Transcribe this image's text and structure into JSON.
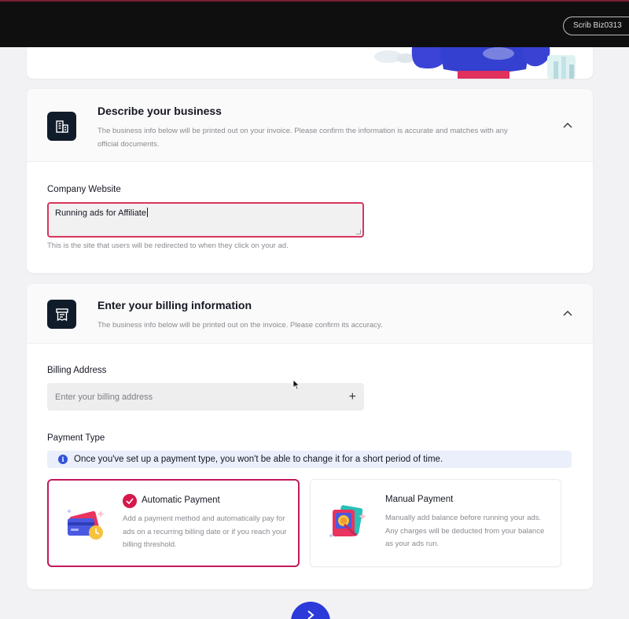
{
  "topbar": {
    "account_name": "Scrib Biz0313"
  },
  "business_section": {
    "title": "Describe your business",
    "description": "The business info below will be printed out on your invoice. Please confirm the information is accurate and matches with any official documents.",
    "icon": "building-icon",
    "website_label": "Company Website",
    "website_value": "Running ads for Affiliate",
    "website_helper": "This is the site that users will be redirected to when they click on your ad."
  },
  "billing_section": {
    "title": "Enter your billing information",
    "description": "The business info below will be printed out on the invoice. Please confirm its accuracy.",
    "icon": "invoice-icon",
    "address_label": "Billing Address",
    "address_placeholder": "Enter your billing address",
    "payment_type_label": "Payment Type",
    "info_notice": "Once you've set up a payment type, you won't be able to change it for a short period of time.",
    "payment_options": [
      {
        "title": "Automatic Payment",
        "description": "Add a payment method and automatically pay for ads on a recurring billing date or if you reach your billing threshold.",
        "selected": true
      },
      {
        "title": "Manual Payment",
        "description": "Manually add balance before running your ads. Any charges will be deducted from your balance as your ads run.",
        "selected": false
      }
    ]
  },
  "colors": {
    "accent": "#d8184a",
    "selected_border": "#c3185c",
    "primary_button": "#2b3ad8",
    "info_background": "#eaeffb",
    "icon_tile": "#111c2a"
  }
}
